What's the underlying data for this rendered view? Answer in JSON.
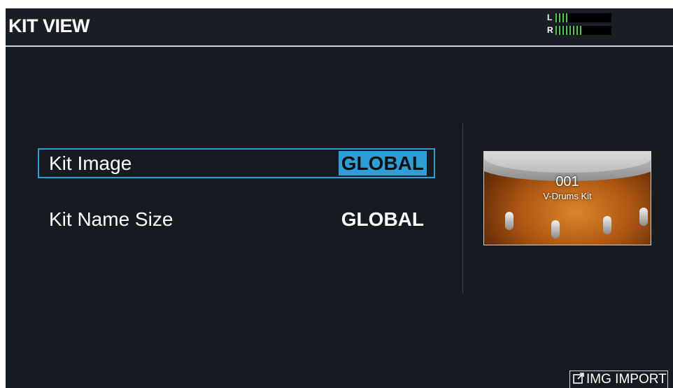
{
  "header": {
    "title": "KIT VIEW",
    "level_meter": {
      "left_label": "L",
      "right_label": "R",
      "left_level": 0.25,
      "right_level": 0.5,
      "meter_color": "#37d63a"
    }
  },
  "params": [
    {
      "label": "Kit Image",
      "value": "GLOBAL",
      "selected": true
    },
    {
      "label": "Kit Name Size",
      "value": "GLOBAL",
      "selected": false
    }
  ],
  "preview": {
    "number": "001",
    "name": "V-Drums Kit"
  },
  "footer": {
    "import_label": "IMG IMPORT",
    "import_icon": "external-link-icon"
  },
  "colors": {
    "background": "#161b21",
    "accent": "#2b9fd6"
  }
}
